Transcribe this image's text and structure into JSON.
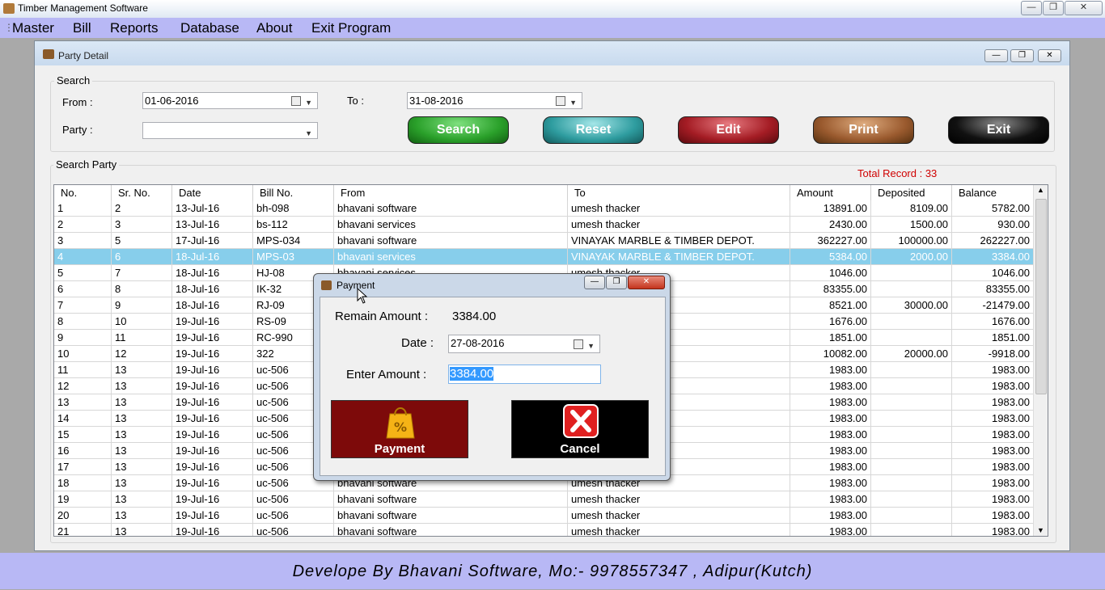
{
  "window": {
    "title": "Timber Management Software",
    "controls": [
      "—",
      "❐",
      "✕"
    ]
  },
  "menu": [
    "Master",
    "Bill",
    "Reports",
    "Database",
    "About",
    "Exit Program"
  ],
  "party_window": {
    "title": "Party Detail",
    "controls": [
      "—",
      "❐",
      "✕"
    ]
  },
  "search": {
    "group_label": "Search",
    "from_label": "From :",
    "from_value": "01-06-2016",
    "to_label": "To :",
    "to_value": "31-08-2016",
    "party_label": "Party :",
    "party_value": ""
  },
  "buttons": [
    {
      "label": "Search",
      "color": "#2aa02a"
    },
    {
      "label": "Reset",
      "color": "#2e9c9f"
    },
    {
      "label": "Edit",
      "color": "#a41c24"
    },
    {
      "label": "Print",
      "color": "#9a5a2e"
    },
    {
      "label": "Exit",
      "color": "#111111"
    }
  ],
  "results": {
    "group_label": "Search Party",
    "total_record": "Total Record : 33",
    "columns": [
      "No.",
      "Sr. No.",
      "Date",
      "Bill No.",
      "From",
      "To",
      "Amount",
      "Deposited",
      "Balance"
    ],
    "rows": [
      [
        "1",
        "2",
        "13-Jul-16",
        "bh-098",
        "bhavani software",
        "umesh thacker",
        "13891.00",
        "8109.00",
        "5782.00"
      ],
      [
        "2",
        "3",
        "13-Jul-16",
        "bs-112",
        "bhavani services",
        "umesh thacker",
        "2430.00",
        "1500.00",
        "930.00"
      ],
      [
        "3",
        "5",
        "17-Jul-16",
        "MPS-034",
        "bhavani software",
        "VINAYAK MARBLE & TIMBER DEPOT.",
        "362227.00",
        "100000.00",
        "262227.00"
      ],
      [
        "4",
        "6",
        "18-Jul-16",
        "MPS-03",
        "bhavani services",
        "VINAYAK MARBLE & TIMBER DEPOT.",
        "5384.00",
        "2000.00",
        "3384.00"
      ],
      [
        "5",
        "7",
        "18-Jul-16",
        "HJ-08",
        "bhavani services",
        "umesh thacker",
        "1046.00",
        "",
        "1046.00"
      ],
      [
        "6",
        "8",
        "18-Jul-16",
        "IK-32",
        "",
        "",
        "83355.00",
        "",
        "83355.00"
      ],
      [
        "7",
        "9",
        "18-Jul-16",
        "RJ-09",
        "",
        "",
        "8521.00",
        "30000.00",
        "-21479.00"
      ],
      [
        "8",
        "10",
        "19-Jul-16",
        "RS-09",
        "",
        "",
        "1676.00",
        "",
        "1676.00"
      ],
      [
        "9",
        "11",
        "19-Jul-16",
        "RC-990",
        "",
        "",
        "1851.00",
        "",
        "1851.00"
      ],
      [
        "10",
        "12",
        "19-Jul-16",
        "322",
        "",
        "",
        "10082.00",
        "20000.00",
        "-9918.00"
      ],
      [
        "11",
        "13",
        "19-Jul-16",
        "uc-506",
        "",
        "",
        "1983.00",
        "",
        "1983.00"
      ],
      [
        "12",
        "13",
        "19-Jul-16",
        "uc-506",
        "",
        "",
        "1983.00",
        "",
        "1983.00"
      ],
      [
        "13",
        "13",
        "19-Jul-16",
        "uc-506",
        "",
        "",
        "1983.00",
        "",
        "1983.00"
      ],
      [
        "14",
        "13",
        "19-Jul-16",
        "uc-506",
        "",
        "",
        "1983.00",
        "",
        "1983.00"
      ],
      [
        "15",
        "13",
        "19-Jul-16",
        "uc-506",
        "",
        "",
        "1983.00",
        "",
        "1983.00"
      ],
      [
        "16",
        "13",
        "19-Jul-16",
        "uc-506",
        "",
        "",
        "1983.00",
        "",
        "1983.00"
      ],
      [
        "17",
        "13",
        "19-Jul-16",
        "uc-506",
        "",
        "",
        "1983.00",
        "",
        "1983.00"
      ],
      [
        "18",
        "13",
        "19-Jul-16",
        "uc-506",
        "bhavani software",
        "umesh thacker",
        "1983.00",
        "",
        "1983.00"
      ],
      [
        "19",
        "13",
        "19-Jul-16",
        "uc-506",
        "bhavani software",
        "umesh thacker",
        "1983.00",
        "",
        "1983.00"
      ],
      [
        "20",
        "13",
        "19-Jul-16",
        "uc-506",
        "bhavani software",
        "umesh thacker",
        "1983.00",
        "",
        "1983.00"
      ],
      [
        "21",
        "13",
        "19-Jul-16",
        "uc-506",
        "bhavani software",
        "umesh thacker",
        "1983.00",
        "",
        "1983.00"
      ]
    ],
    "selected_row": 3,
    "highlight_color": "#87ceeb"
  },
  "payment_dialog": {
    "title": "Payment",
    "controls": [
      "—",
      "❐",
      "✕"
    ],
    "remain_label": "Remain Amount :",
    "remain_value": "3384.00",
    "date_label": "Date :",
    "date_value": "27-08-2016",
    "amount_label": "Enter Amount :",
    "amount_value": "3384.00",
    "payment_button": "Payment",
    "cancel_button": "Cancel",
    "payment_color": "#7d0a0a",
    "cancel_color": "#000000"
  },
  "footer": "Develope By Bhavani Software, Mo:- 9978557347 , Adipur(Kutch)"
}
